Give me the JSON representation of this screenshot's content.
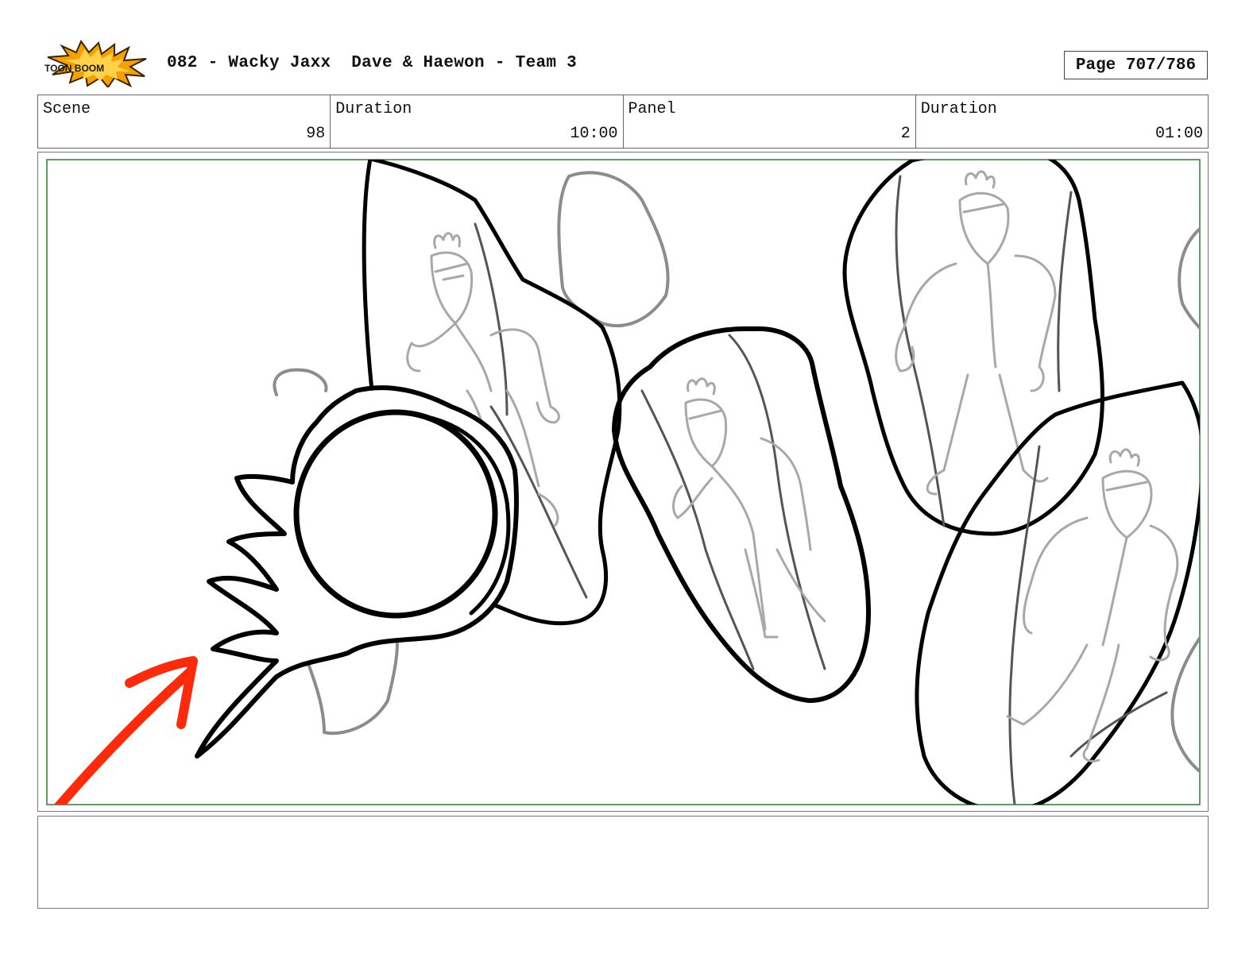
{
  "header": {
    "logo_text": "TOON BOOM",
    "title": "082 - Wacky Jaxx  Dave & Haewon - Team 3",
    "page_label": "Page 707/786"
  },
  "info": {
    "scene_label": "Scene",
    "scene_value": "98",
    "scene_duration_label": "Duration",
    "scene_duration_value": "10:00",
    "panel_label": "Panel",
    "panel_value": "2",
    "panel_duration_label": "Duration",
    "panel_duration_value": "01:00"
  },
  "colors": {
    "safe_frame": "#2e7d32",
    "arrow": "#ff2a0a",
    "ink": "#000000",
    "sketch": "#9a9a9a"
  },
  "notes": {
    "text": ""
  }
}
